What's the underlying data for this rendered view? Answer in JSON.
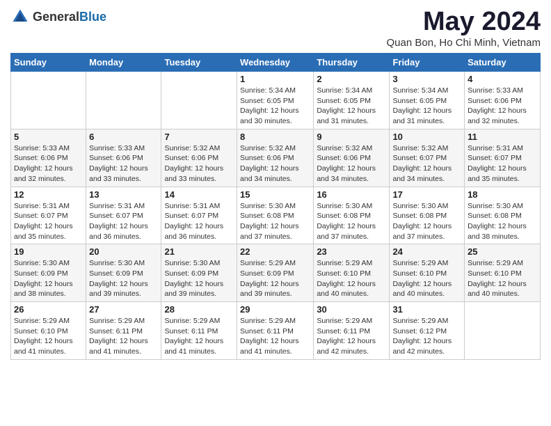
{
  "header": {
    "logo": {
      "general": "General",
      "blue": "Blue"
    },
    "title": "May 2024",
    "location": "Quan Bon, Ho Chi Minh, Vietnam"
  },
  "calendar": {
    "days_of_week": [
      "Sunday",
      "Monday",
      "Tuesday",
      "Wednesday",
      "Thursday",
      "Friday",
      "Saturday"
    ],
    "weeks": [
      [
        {
          "day": "",
          "info": ""
        },
        {
          "day": "",
          "info": ""
        },
        {
          "day": "",
          "info": ""
        },
        {
          "day": "1",
          "info": "Sunrise: 5:34 AM\nSunset: 6:05 PM\nDaylight: 12 hours\nand 30 minutes."
        },
        {
          "day": "2",
          "info": "Sunrise: 5:34 AM\nSunset: 6:05 PM\nDaylight: 12 hours\nand 31 minutes."
        },
        {
          "day": "3",
          "info": "Sunrise: 5:34 AM\nSunset: 6:05 PM\nDaylight: 12 hours\nand 31 minutes."
        },
        {
          "day": "4",
          "info": "Sunrise: 5:33 AM\nSunset: 6:06 PM\nDaylight: 12 hours\nand 32 minutes."
        }
      ],
      [
        {
          "day": "5",
          "info": "Sunrise: 5:33 AM\nSunset: 6:06 PM\nDaylight: 12 hours\nand 32 minutes."
        },
        {
          "day": "6",
          "info": "Sunrise: 5:33 AM\nSunset: 6:06 PM\nDaylight: 12 hours\nand 33 minutes."
        },
        {
          "day": "7",
          "info": "Sunrise: 5:32 AM\nSunset: 6:06 PM\nDaylight: 12 hours\nand 33 minutes."
        },
        {
          "day": "8",
          "info": "Sunrise: 5:32 AM\nSunset: 6:06 PM\nDaylight: 12 hours\nand 34 minutes."
        },
        {
          "day": "9",
          "info": "Sunrise: 5:32 AM\nSunset: 6:06 PM\nDaylight: 12 hours\nand 34 minutes."
        },
        {
          "day": "10",
          "info": "Sunrise: 5:32 AM\nSunset: 6:07 PM\nDaylight: 12 hours\nand 34 minutes."
        },
        {
          "day": "11",
          "info": "Sunrise: 5:31 AM\nSunset: 6:07 PM\nDaylight: 12 hours\nand 35 minutes."
        }
      ],
      [
        {
          "day": "12",
          "info": "Sunrise: 5:31 AM\nSunset: 6:07 PM\nDaylight: 12 hours\nand 35 minutes."
        },
        {
          "day": "13",
          "info": "Sunrise: 5:31 AM\nSunset: 6:07 PM\nDaylight: 12 hours\nand 36 minutes."
        },
        {
          "day": "14",
          "info": "Sunrise: 5:31 AM\nSunset: 6:07 PM\nDaylight: 12 hours\nand 36 minutes."
        },
        {
          "day": "15",
          "info": "Sunrise: 5:30 AM\nSunset: 6:08 PM\nDaylight: 12 hours\nand 37 minutes."
        },
        {
          "day": "16",
          "info": "Sunrise: 5:30 AM\nSunset: 6:08 PM\nDaylight: 12 hours\nand 37 minutes."
        },
        {
          "day": "17",
          "info": "Sunrise: 5:30 AM\nSunset: 6:08 PM\nDaylight: 12 hours\nand 37 minutes."
        },
        {
          "day": "18",
          "info": "Sunrise: 5:30 AM\nSunset: 6:08 PM\nDaylight: 12 hours\nand 38 minutes."
        }
      ],
      [
        {
          "day": "19",
          "info": "Sunrise: 5:30 AM\nSunset: 6:09 PM\nDaylight: 12 hours\nand 38 minutes."
        },
        {
          "day": "20",
          "info": "Sunrise: 5:30 AM\nSunset: 6:09 PM\nDaylight: 12 hours\nand 39 minutes."
        },
        {
          "day": "21",
          "info": "Sunrise: 5:30 AM\nSunset: 6:09 PM\nDaylight: 12 hours\nand 39 minutes."
        },
        {
          "day": "22",
          "info": "Sunrise: 5:29 AM\nSunset: 6:09 PM\nDaylight: 12 hours\nand 39 minutes."
        },
        {
          "day": "23",
          "info": "Sunrise: 5:29 AM\nSunset: 6:10 PM\nDaylight: 12 hours\nand 40 minutes."
        },
        {
          "day": "24",
          "info": "Sunrise: 5:29 AM\nSunset: 6:10 PM\nDaylight: 12 hours\nand 40 minutes."
        },
        {
          "day": "25",
          "info": "Sunrise: 5:29 AM\nSunset: 6:10 PM\nDaylight: 12 hours\nand 40 minutes."
        }
      ],
      [
        {
          "day": "26",
          "info": "Sunrise: 5:29 AM\nSunset: 6:10 PM\nDaylight: 12 hours\nand 41 minutes."
        },
        {
          "day": "27",
          "info": "Sunrise: 5:29 AM\nSunset: 6:11 PM\nDaylight: 12 hours\nand 41 minutes."
        },
        {
          "day": "28",
          "info": "Sunrise: 5:29 AM\nSunset: 6:11 PM\nDaylight: 12 hours\nand 41 minutes."
        },
        {
          "day": "29",
          "info": "Sunrise: 5:29 AM\nSunset: 6:11 PM\nDaylight: 12 hours\nand 41 minutes."
        },
        {
          "day": "30",
          "info": "Sunrise: 5:29 AM\nSunset: 6:11 PM\nDaylight: 12 hours\nand 42 minutes."
        },
        {
          "day": "31",
          "info": "Sunrise: 5:29 AM\nSunset: 6:12 PM\nDaylight: 12 hours\nand 42 minutes."
        },
        {
          "day": "",
          "info": ""
        }
      ]
    ]
  }
}
